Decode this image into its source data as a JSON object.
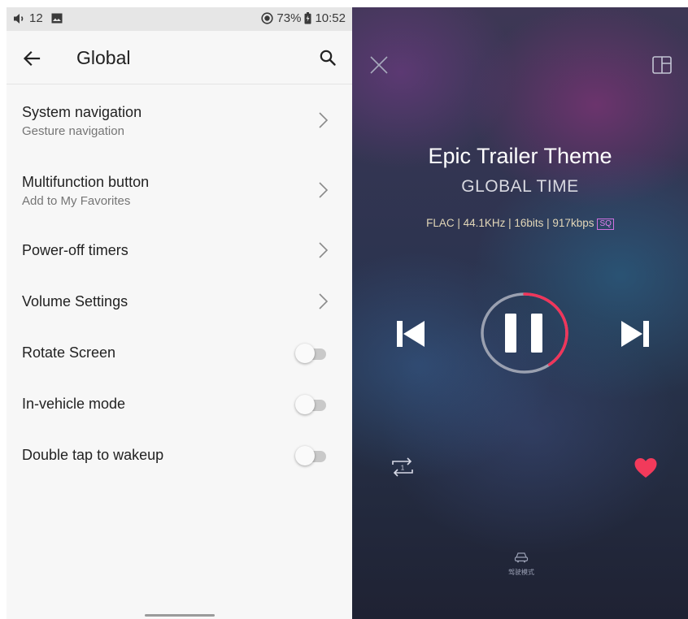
{
  "status_bar": {
    "volume": "12",
    "battery": "73%",
    "time": "10:52"
  },
  "settings": {
    "title": "Global",
    "rows": [
      {
        "title": "System navigation",
        "subtitle": "Gesture navigation",
        "control": "chevron"
      },
      {
        "title": "Multifunction button",
        "subtitle": "Add to My Favorites",
        "control": "chevron"
      },
      {
        "title": "Power-off timers",
        "control": "chevron"
      },
      {
        "title": "Volume Settings",
        "control": "chevron"
      },
      {
        "title": "Rotate Screen",
        "control": "toggle",
        "on": false
      },
      {
        "title": "In-vehicle mode",
        "control": "toggle",
        "on": false
      },
      {
        "title": "Double tap to wakeup",
        "control": "toggle",
        "on": false
      }
    ]
  },
  "player": {
    "track_title": "Epic Trailer Theme",
    "artist": "GLOBAL TIME",
    "audio_info": "FLAC | 44.1KHz | 16bits | 917kbps",
    "quality_badge": "SQ",
    "repeat_mode_badge": "1",
    "drive_mode_label": "驾驶模式",
    "playback_progress": 0.4,
    "colors": {
      "accent": "#f0355a",
      "heart": "#f23a5b",
      "ring_track": "#9aa0b0"
    }
  },
  "icons": {
    "status": [
      "volume-icon",
      "image-icon",
      "do-not-disturb-icon",
      "battery-icon"
    ],
    "appbar": [
      "back-arrow-icon",
      "search-icon"
    ],
    "player": [
      "close-icon",
      "layout-toggle-icon",
      "previous-track-icon",
      "pause-icon",
      "next-track-icon",
      "repeat-one-icon",
      "heart-icon",
      "car-icon"
    ]
  }
}
